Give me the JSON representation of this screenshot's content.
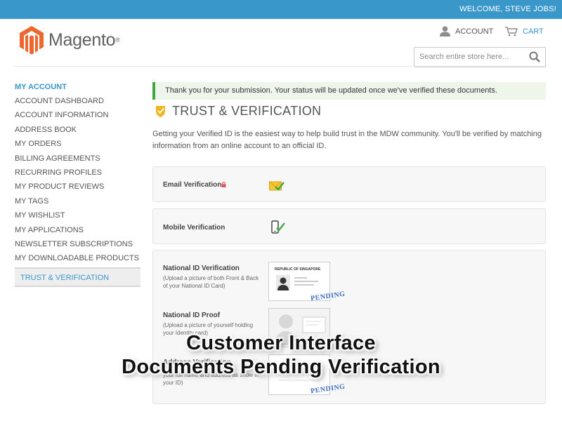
{
  "header": {
    "welcome": "WELCOME, STEVE JOBS!",
    "logo_text": "Magento",
    "logo_reg": "®",
    "account_label": "ACCOUNT",
    "cart_label": "CART",
    "search_placeholder": "Search entire store here..."
  },
  "colors": {
    "brand_blue": "#3a97c9",
    "success_green": "#3fa83f",
    "logo_orange": "#ee672f"
  },
  "sidebar": {
    "title": "MY ACCOUNT",
    "items": [
      {
        "label": "ACCOUNT DASHBOARD"
      },
      {
        "label": "ACCOUNT INFORMATION"
      },
      {
        "label": "ADDRESS BOOK"
      },
      {
        "label": "MY ORDERS"
      },
      {
        "label": "BILLING AGREEMENTS"
      },
      {
        "label": "RECURRING PROFILES"
      },
      {
        "label": "MY PRODUCT REVIEWS"
      },
      {
        "label": "MY TAGS"
      },
      {
        "label": "MY WISHLIST"
      },
      {
        "label": "MY APPLICATIONS"
      },
      {
        "label": "NEWSLETTER SUBSCRIPTIONS"
      },
      {
        "label": "MY DOWNLOADABLE PRODUCTS"
      }
    ],
    "active": "TRUST & VERIFICATION"
  },
  "main": {
    "notice": "Thank you for your submission. Your status will be updated once we've verified these documents.",
    "title": "TRUST & VERIFICATION",
    "intro": "Getting your Verified ID is the easiest way to help build trust in the MDW community. You'll be verified by matching information from an online account to an official ID.",
    "email": {
      "label": "Email Verification",
      "icon": "envelope-check-icon"
    },
    "mobile": {
      "label": "Mobile Verification",
      "icon": "phone-check-icon"
    },
    "national_id": {
      "label": "National ID Verification",
      "sub": "(Upload a picture of both Front & Back of your National ID Card)",
      "card_heading": "REPUBLIC OF SINGAPORE",
      "status": "PENDING"
    },
    "id_proof": {
      "label": "National ID Proof",
      "sub": "(Upload a picture of yourself holding your Identity card)"
    },
    "address": {
      "label": "Address Verification",
      "sub": "your full name and address as show in your ID)",
      "status": "PENDING"
    }
  },
  "overlay": {
    "line1": "Customer Interface",
    "line2": "Documents Pending Verification"
  }
}
